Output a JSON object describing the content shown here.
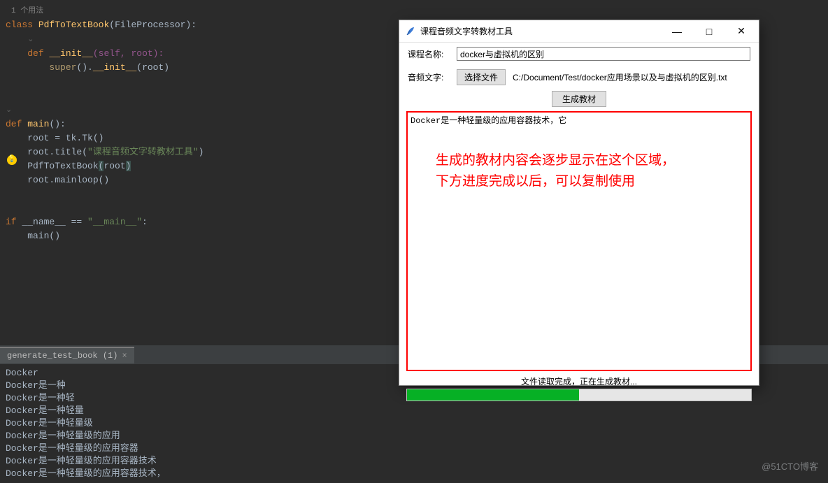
{
  "usage_hint": "1 个用法",
  "code": {
    "l1_kw_class": "class",
    "l1_name": "PdfToTextBook",
    "l1_paren_open": "(",
    "l1_base": "FileProcessor",
    "l1_paren_close": "):",
    "l2_kw_def": "def",
    "l2_name": "__init__",
    "l2_params": "(self, root):",
    "l3_super": "super",
    "l3_rest": "().",
    "l3_init": "__init__",
    "l3_args": "(root)",
    "l4_kw_def": "def",
    "l4_name": "main",
    "l4_paren": "():",
    "l5": "root = tk.Tk()",
    "l6a": "root.title(",
    "l6s": "\"课程音频文字转教材工具\"",
    "l6b": ")",
    "l7a": "PdfToTextBook",
    "l7b": "(",
    "l7c": "root",
    "l7d": ")",
    "l8": "root.mainloop()",
    "l9_if": "if",
    "l9_name": " __name__ == ",
    "l9_str": "\"__main__\"",
    "l9_colon": ":",
    "l10": "main()"
  },
  "console": {
    "tab_label": "generate_test_book (1)",
    "lines": [
      "Docker",
      "Docker是一种",
      "Docker是一种轻",
      "Docker是一种轻量",
      "Docker是一种轻量级",
      "Docker是一种轻量级的应用",
      "Docker是一种轻量级的应用容器",
      "Docker是一种轻量级的应用容器技术",
      "Docker是一种轻量级的应用容器技术，"
    ]
  },
  "dialog": {
    "title": "课程音频文字转教材工具",
    "course_label": "课程名称:",
    "course_value": "docker与虚拟机的区别",
    "audio_label": "音频文字:",
    "choose_file": "选择文件",
    "file_path": "C:/Document/Test/docker应用场景以及与虚拟机的区别.txt",
    "generate": "生成教材",
    "textarea_content": "Docker是一种轻量级的应用容器技术，它",
    "overlay_line1": "生成的教材内容会逐步显示在这个区域，",
    "overlay_line2": "下方进度完成以后，可以复制使用",
    "status": "文件读取完成，正在生成教材...",
    "progress_percent": 50
  },
  "watermark": "@51CTO博客"
}
